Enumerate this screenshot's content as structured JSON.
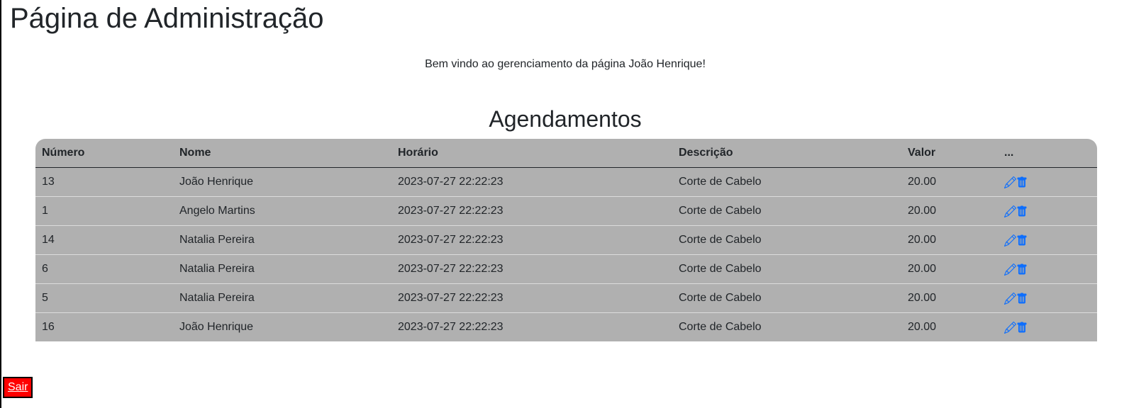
{
  "page": {
    "title": "Página de Administração",
    "welcome": "Bem vindo ao gerenciamento da página João Henrique!",
    "section_title": "Agendamentos"
  },
  "table": {
    "headers": [
      "Número",
      "Nome",
      "Horário",
      "Descrição",
      "Valor",
      "..."
    ],
    "rows": [
      {
        "numero": "13",
        "nome": "João Henrique",
        "horario": "2023-07-27 22:22:23",
        "descricao": "Corte de Cabelo",
        "valor": "20.00"
      },
      {
        "numero": "1",
        "nome": "Angelo Martins",
        "horario": "2023-07-27 22:22:23",
        "descricao": "Corte de Cabelo",
        "valor": "20.00"
      },
      {
        "numero": "14",
        "nome": "Natalia Pereira",
        "horario": "2023-07-27 22:22:23",
        "descricao": "Corte de Cabelo",
        "valor": "20.00"
      },
      {
        "numero": "6",
        "nome": "Natalia Pereira",
        "horario": "2023-07-27 22:22:23",
        "descricao": "Corte de Cabelo",
        "valor": "20.00"
      },
      {
        "numero": "5",
        "nome": "Natalia Pereira",
        "horario": "2023-07-27 22:22:23",
        "descricao": "Corte de Cabelo",
        "valor": "20.00"
      },
      {
        "numero": "16",
        "nome": "João Henrique",
        "horario": "2023-07-27 22:22:23",
        "descricao": "Corte de Cabelo",
        "valor": "20.00"
      }
    ],
    "row_actions": [
      "pencil-icon",
      "trash-icon"
    ]
  },
  "footer": {
    "logout_label": "Sair"
  },
  "colors": {
    "table_bg": "#b0b0b0",
    "icon_blue": "#0d6efd",
    "logout_bg": "#ff0000"
  }
}
